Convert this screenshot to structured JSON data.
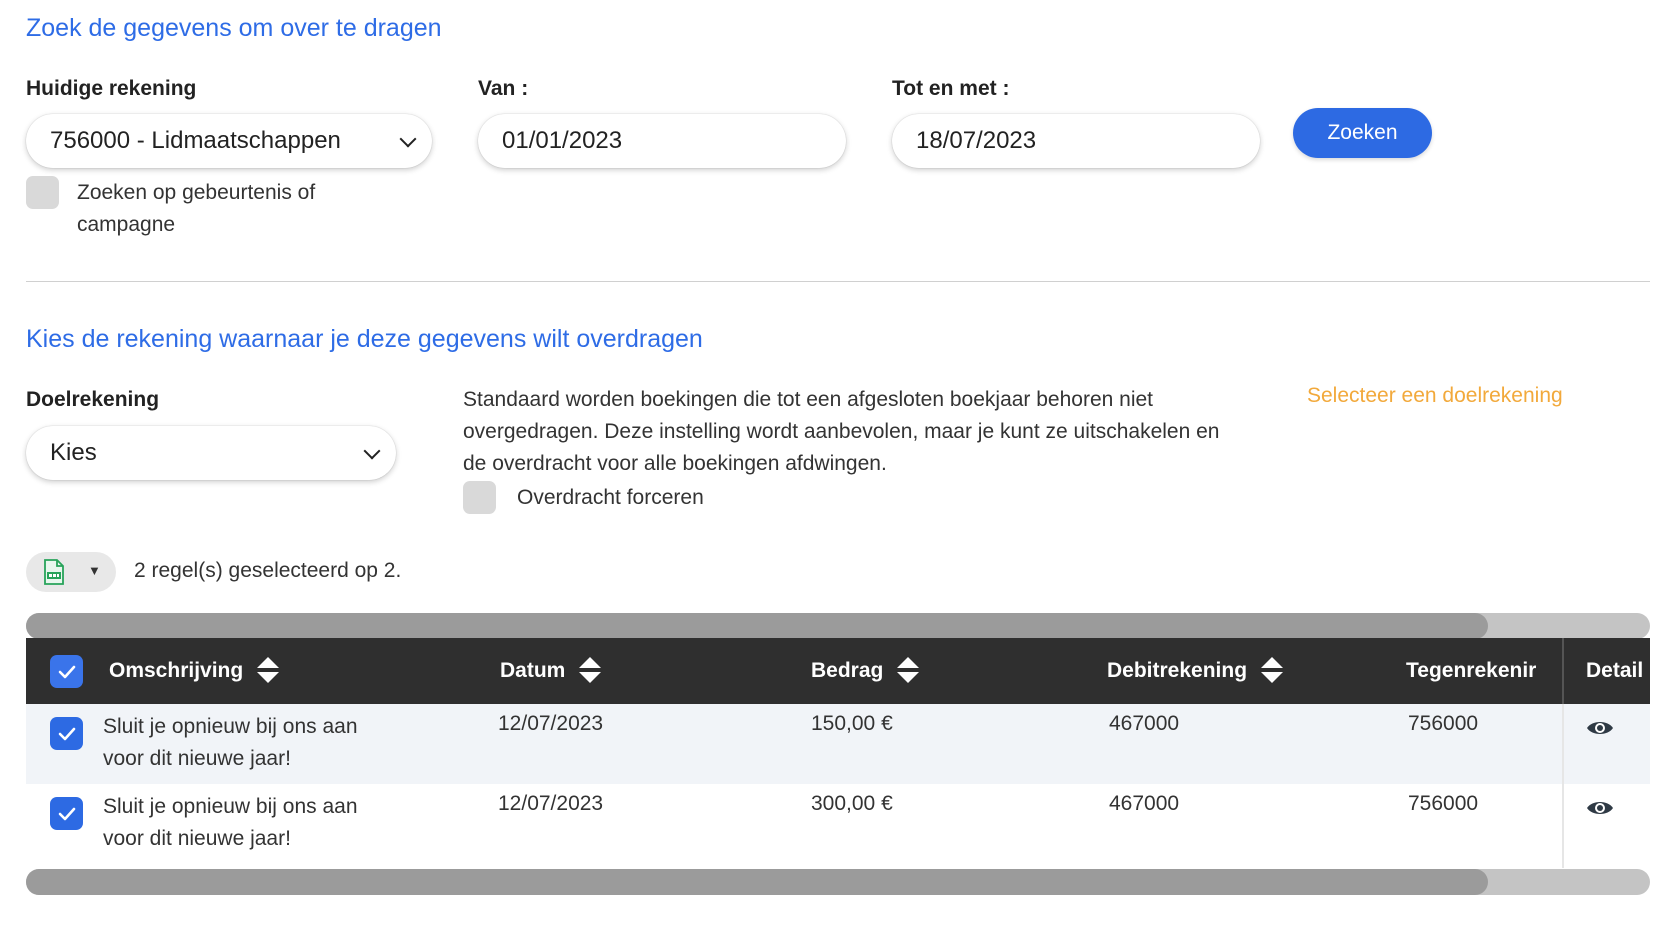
{
  "search_section": {
    "title": "Zoek de gegevens om over te dragen",
    "account_label": "Huidige rekening",
    "account_value": "756000 - Lidmaatschappen",
    "from_label": "Van :",
    "from_value": "01/01/2023",
    "to_label": "Tot en met :",
    "to_value": "18/07/2023",
    "search_button": "Zoeken",
    "event_checkbox_line1": "Zoeken op gebeurtenis of",
    "event_checkbox_line2": "campagne"
  },
  "target_section": {
    "title": "Kies de rekening waarnaar je deze gegevens wilt overdragen",
    "target_label": "Doelrekening",
    "target_value": "Kies",
    "info_line1": "Standaard worden boekingen die tot een afgesloten boekjaar behoren niet",
    "info_line2": "overgedragen. Deze instelling wordt aanbevolen, maar je kunt ze uitschakelen en",
    "info_line3": "de overdracht voor alle boekingen afdwingen.",
    "force_label": "Overdracht forceren",
    "warning": "Selecteer een doelrekening"
  },
  "selection": {
    "summary": "2 regel(s) geselecteerd op 2.",
    "export_icon": "spreadsheet-export-icon"
  },
  "table": {
    "columns": {
      "description": "Omschrijving",
      "date": "Datum",
      "amount": "Bedrag",
      "debit": "Debitrekening",
      "counter": "Tegenrekenir",
      "detail": "Detail"
    },
    "rows": [
      {
        "description_line1": "Sluit je opnieuw bij ons aan",
        "description_line2": "voor dit nieuwe jaar!",
        "date": "12/07/2023",
        "amount": "150,00 €",
        "debit": "467000",
        "counter": "756000"
      },
      {
        "description_line1": "Sluit je opnieuw bij ons aan",
        "description_line2": "voor dit nieuwe jaar!",
        "date": "12/07/2023",
        "amount": "300,00 €",
        "debit": "467000",
        "counter": "756000"
      }
    ]
  },
  "colors": {
    "accent": "#2d6ae3",
    "heading": "#2e6ce6",
    "warning": "#f2a93b",
    "table_header": "#2f2f2f"
  }
}
